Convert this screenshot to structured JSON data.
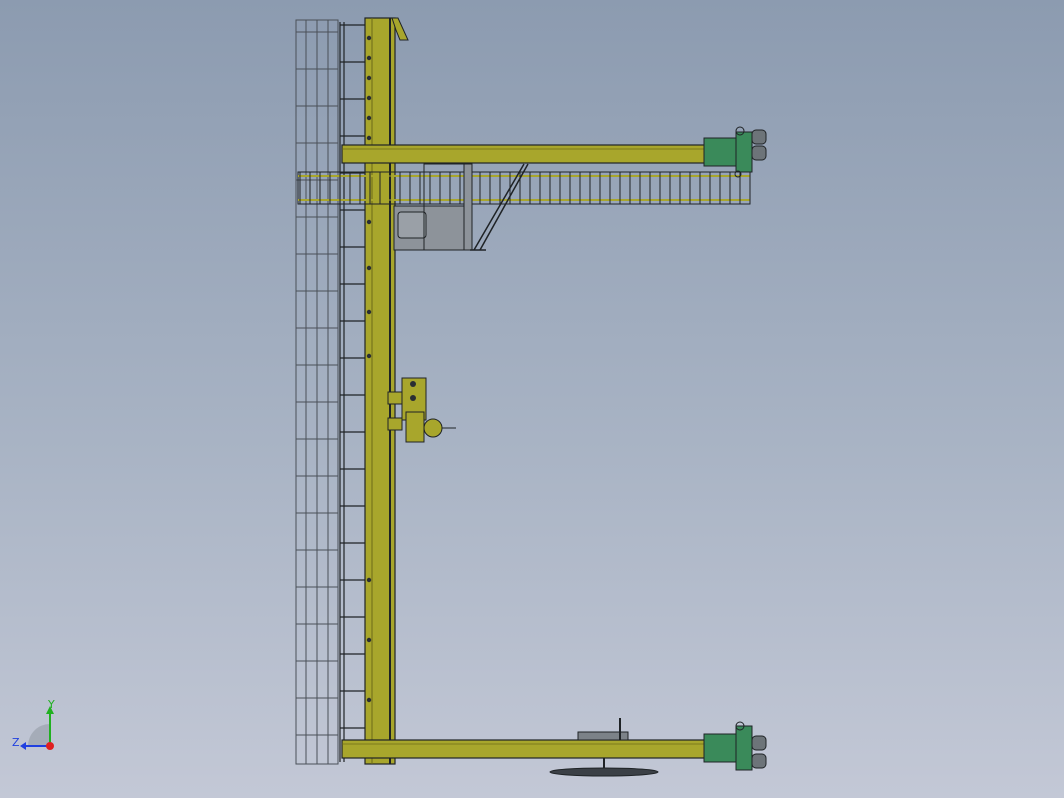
{
  "viewport": {
    "background_top": "#8c9bb0",
    "background_bottom": "#c3c8d6"
  },
  "colors": {
    "steel_yellow": "#a8a62c",
    "steel_yellow_dark": "#6d6b18",
    "outline": "#1f2326",
    "cage_line": "#4a5058",
    "trolley_green": "#3a8a5a",
    "cabin_grey": "#8d939a",
    "axis_x": "#e02020",
    "axis_y": "#20b020",
    "axis_z": "#2040e0"
  },
  "axis_triad": {
    "y_label": "Y",
    "z_label": "Z",
    "icon": "coordinate-triad-icon"
  }
}
